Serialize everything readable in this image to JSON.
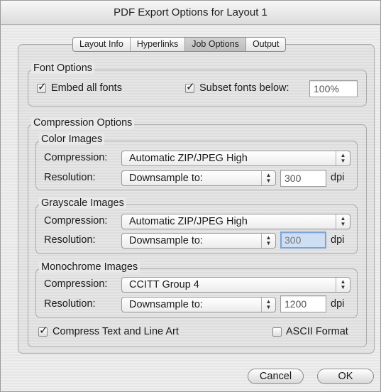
{
  "window": {
    "title": "PDF Export Options for Layout 1"
  },
  "tabs": [
    {
      "label": "Layout Info"
    },
    {
      "label": "Hyperlinks"
    },
    {
      "label": "Job Options"
    },
    {
      "label": "Output"
    }
  ],
  "font_options": {
    "title": "Font Options",
    "embed_all_fonts": {
      "label": "Embed all fonts",
      "checked": true
    },
    "subset_fonts": {
      "label": "Subset fonts below:",
      "checked": true,
      "value": "100%"
    }
  },
  "compression_options": {
    "title": "Compression Options",
    "color_images": {
      "title": "Color Images",
      "compression_label": "Compression:",
      "compression_value": "Automatic ZIP/JPEG High",
      "resolution_label": "Resolution:",
      "resolution_value": "Downsample to:",
      "dpi_value": "300",
      "dpi_unit": "dpi"
    },
    "grayscale_images": {
      "title": "Grayscale Images",
      "compression_label": "Compression:",
      "compression_value": "Automatic ZIP/JPEG High",
      "resolution_label": "Resolution:",
      "resolution_value": "Downsample to:",
      "dpi_value": "300",
      "dpi_unit": "dpi"
    },
    "monochrome_images": {
      "title": "Monochrome Images",
      "compression_label": "Compression:",
      "compression_value": "CCITT Group 4",
      "resolution_label": "Resolution:",
      "resolution_value": "Downsample to:",
      "dpi_value": "1200",
      "dpi_unit": "dpi"
    },
    "compress_text": {
      "label": "Compress Text and Line Art",
      "checked": true
    },
    "ascii_format": {
      "label": "ASCII Format",
      "checked": false
    }
  },
  "buttons": {
    "cancel": "Cancel",
    "ok": "OK"
  },
  "glyphs": {
    "check": "✓",
    "arrow_up": "▲",
    "arrow_down": "▼"
  }
}
